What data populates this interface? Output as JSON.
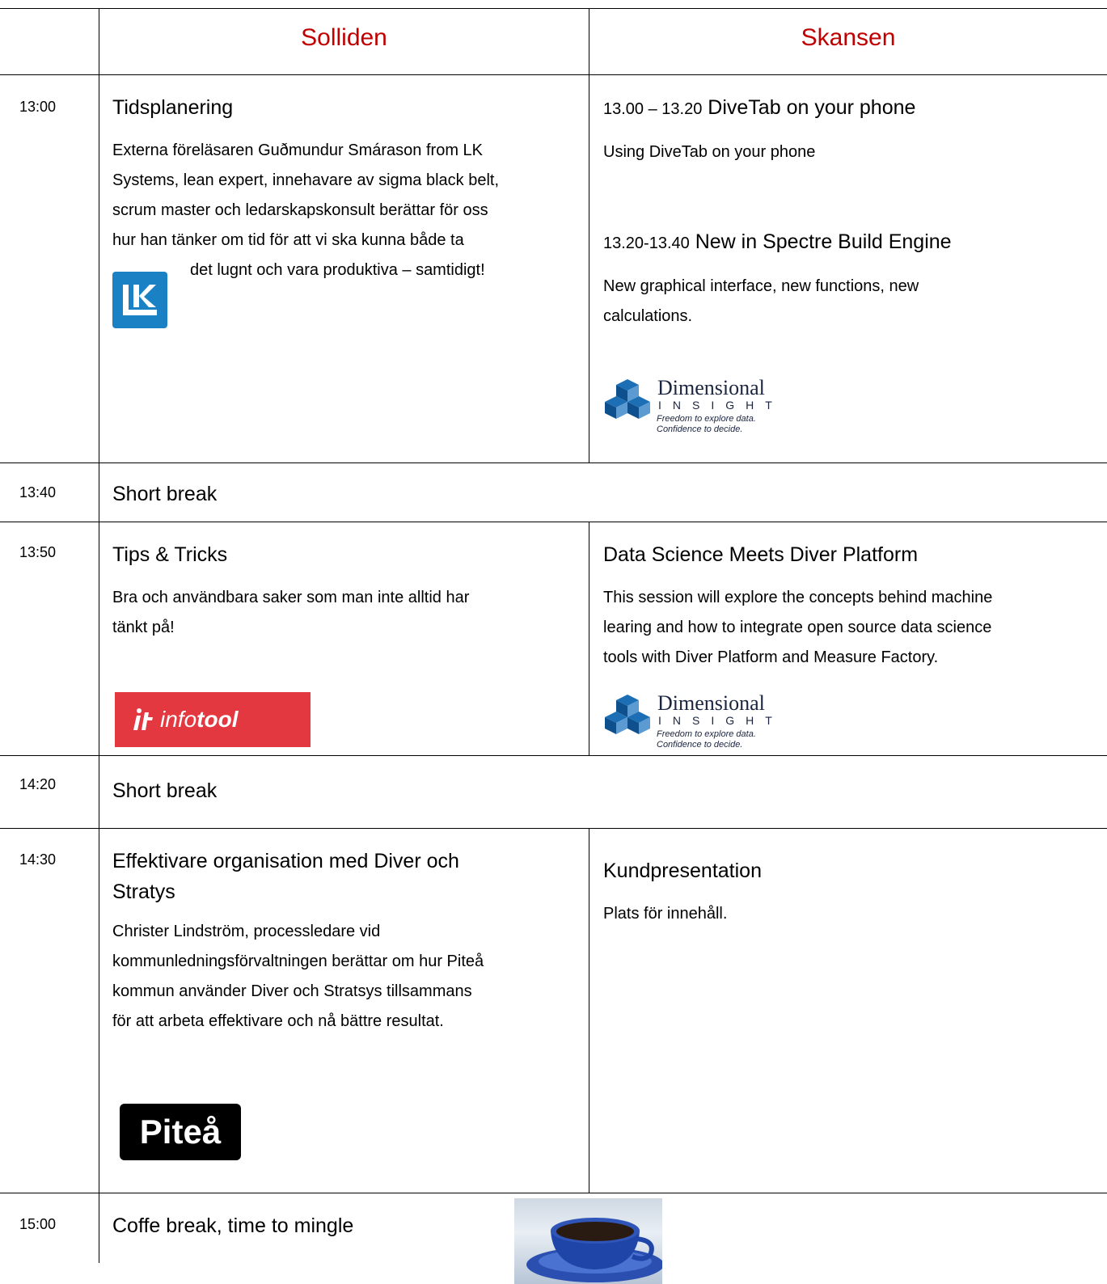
{
  "header": {
    "col1": "Solliden",
    "col2": "Skansen"
  },
  "colors": {
    "header_red": "#c00000",
    "lk_blue": "#1a82c4",
    "infotool_red": "#e43840",
    "dimensional_blue": "#1c6fb5"
  },
  "row1": {
    "time": "13:00",
    "left": {
      "title": "Tidsplanering",
      "lines": [
        "Externa föreläsaren Guðmundur Smárason from LK",
        "Systems, lean expert, innehavare av sigma black belt,",
        "scrum master och ledarskapskonsult berättar för oss",
        "hur han tänker om tid för att vi ska kunna både ta",
        "det lugnt och vara produktiva – samtidigt!"
      ],
      "logo_text": "LK"
    },
    "right": {
      "s1_prefix": "13.00 – 13.20",
      "s1_title": "DiveTab on your phone",
      "s1_body": "Using DiveTab on your phone",
      "s2_prefix": "13.20-13.40",
      "s2_title": "New in Spectre Build Engine",
      "s2_lines": [
        "New graphical interface, new functions, new",
        "calculations."
      ],
      "logo": {
        "name": "Dimensional",
        "sub": "INSIGHT",
        "tag1": "Freedom to explore data.",
        "tag2": "Confidence to decide."
      }
    }
  },
  "row2": {
    "time": "13:40",
    "text": "Short break"
  },
  "row3": {
    "time": "13:50",
    "left": {
      "title": "Tips & Tricks",
      "lines": [
        "Bra och användbara saker som man inte alltid har",
        "tänkt på!"
      ],
      "logo_info": "info",
      "logo_tool": "tool"
    },
    "right": {
      "title": "Data Science Meets Diver Platform",
      "lines": [
        "This session will explore the concepts behind machine",
        "learing and how to integrate open source data science",
        "tools with Diver Platform and Measure Factory."
      ],
      "logo": {
        "name": "Dimensional",
        "sub": "INSIGHT",
        "tag1": "Freedom to explore data.",
        "tag2": "Confidence to decide."
      }
    }
  },
  "row4": {
    "time": "14:20",
    "text": "Short break"
  },
  "row5": {
    "time": "14:30",
    "left": {
      "title_lines": [
        "Effektivare organisation med Diver och",
        "Stratys"
      ],
      "lines": [
        "Christer Lindström, processledare vid",
        "kommunledningsförvaltningen berättar om hur Piteå",
        "kommun använder Diver och Stratsys tillsammans",
        "för att arbeta effektivare och nå bättre resultat."
      ],
      "logo_text": "Piteå"
    },
    "right": {
      "title": "Kundpresentation",
      "body": "Plats för innehåll."
    }
  },
  "row6": {
    "time": "15:00",
    "text": "Coffe break, time to mingle"
  }
}
